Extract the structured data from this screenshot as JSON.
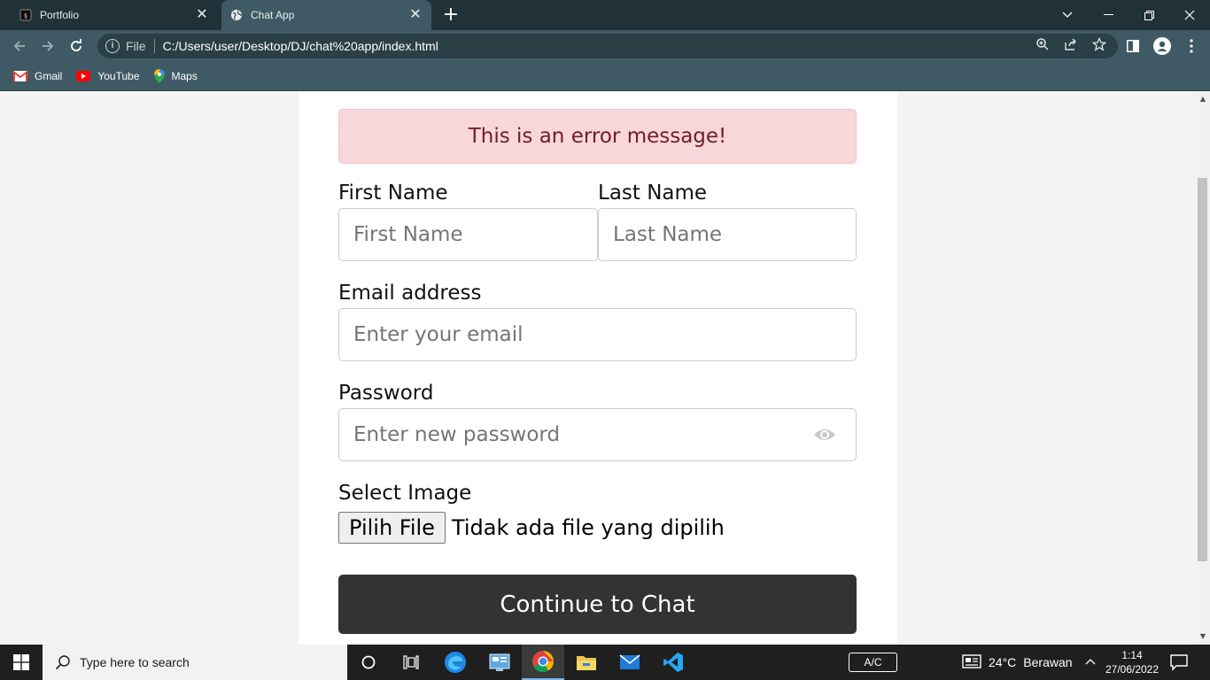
{
  "browser": {
    "tabs": [
      {
        "title": "Portfolio",
        "active": false
      },
      {
        "title": "Chat App",
        "active": true
      }
    ],
    "address": {
      "scheme_label": "File",
      "url": "C:/Users/user/Desktop/DJ/chat%20app/index.html"
    },
    "bookmarks": [
      {
        "label": "Gmail",
        "icon": "gmail-icon"
      },
      {
        "label": "YouTube",
        "icon": "youtube-icon"
      },
      {
        "label": "Maps",
        "icon": "maps-icon"
      }
    ]
  },
  "form": {
    "error_message": "This is an error message!",
    "first_name": {
      "label": "First Name",
      "placeholder": "First Name"
    },
    "last_name": {
      "label": "Last Name",
      "placeholder": "Last Name"
    },
    "email": {
      "label": "Email address",
      "placeholder": "Enter your email"
    },
    "password": {
      "label": "Password",
      "placeholder": "Enter new password"
    },
    "image": {
      "label": "Select Image",
      "button": "Pilih File",
      "status": "Tidak ada file yang dipilih"
    },
    "submit": "Continue to Chat"
  },
  "taskbar": {
    "search_placeholder": "Type here to search",
    "ac_label": "A/C",
    "weather": {
      "temperature": "24°C",
      "condition": "Berawan"
    },
    "clock": {
      "time": "1:14",
      "date": "27/06/2022"
    }
  },
  "colors": {
    "error_bg": "#f8d7da",
    "error_text": "#721c24",
    "submit_bg": "#333333",
    "chrome_tab_bar": "#203138",
    "chrome_toolbar": "#3f5a64"
  }
}
